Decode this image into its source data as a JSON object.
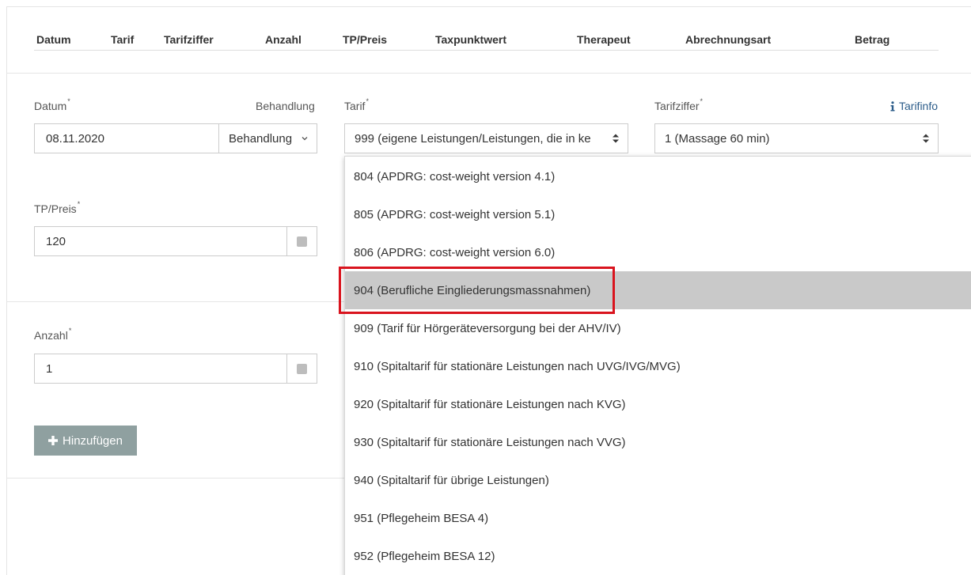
{
  "table_header": {
    "columns": [
      "Datum",
      "Tarif",
      "Tarifziffer",
      "Anzahl",
      "TP/Preis",
      "Taxpunktwert",
      "Therapeut",
      "Abrechnungsart",
      "Betrag"
    ]
  },
  "form": {
    "datum": {
      "label": "Datum",
      "required_mark": "*",
      "value": "08.11.2020"
    },
    "behandlung": {
      "label": "Behandlung",
      "value": "Behandlung"
    },
    "tarif": {
      "label": "Tarif",
      "required_mark": "*",
      "value": "999 (eigene Leistungen/Leistungen, die in ke"
    },
    "tarifziffer": {
      "label": "Tarifziffer",
      "required_mark": "*",
      "value": "1 (Massage 60 min)"
    },
    "tarifinfo": {
      "label": "Tarifinfo",
      "icon": "info-icon"
    },
    "tp_preis": {
      "label": "TP/Preis",
      "required_mark": "*",
      "value": "120"
    },
    "anzahl": {
      "label": "Anzahl",
      "required_mark": "*",
      "value": "1"
    },
    "add_button": {
      "label": "Hinzufügen",
      "icon": "plus-icon"
    }
  },
  "dropdown": {
    "items": [
      "804 (APDRG: cost-weight version 4.1)",
      "805 (APDRG: cost-weight version 5.1)",
      "806 (APDRG: cost-weight version 6.0)",
      "904 (Berufliche Eingliederungsmassnahmen)",
      "909 (Tarif für Hörgeräteversorgung bei der AHV/IV)",
      "910 (Spitaltarif für stationäre Leistungen nach UVG/IVG/MVG)",
      "920 (Spitaltarif für stationäre Leistungen nach KVG)",
      "930 (Spitaltarif für stationäre Leistungen nach VVG)",
      "940 (Spitaltarif für übrige Leistungen)",
      "951 (Pflegeheim BESA 4)",
      "952 (Pflegeheim BESA 12)"
    ],
    "selected_index": 3
  },
  "colors": {
    "highlight_border": "#d9141e",
    "selected_bg": "#c9c9c9",
    "button_bg": "#8fa0a0",
    "link": "#2c5d8a"
  }
}
